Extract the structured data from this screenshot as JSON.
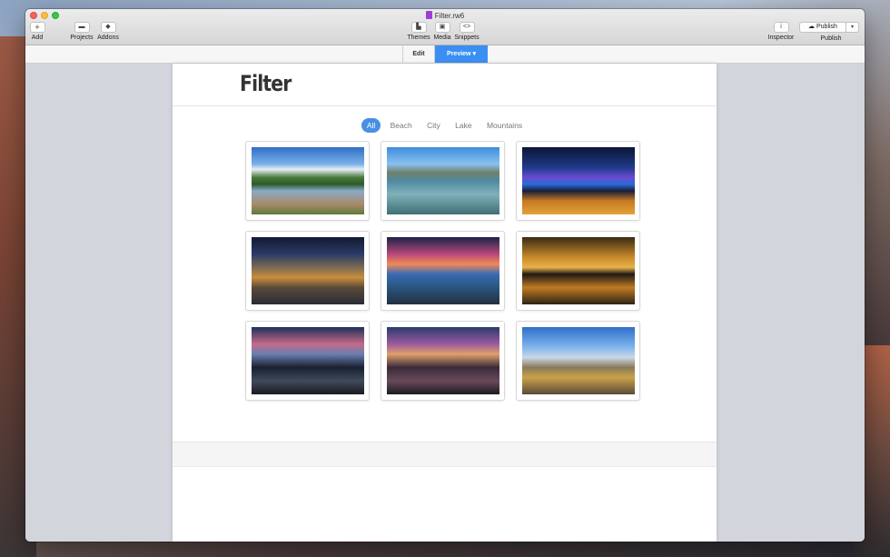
{
  "window": {
    "title": "Filter.rw6"
  },
  "toolbar": {
    "add_icon": "+",
    "add_label": "Add",
    "projects_label": "Projects",
    "addons_label": "Addons",
    "themes_label": "Themes",
    "media_label": "Media",
    "snippets_icon": "<>",
    "snippets_label": "Snippets",
    "inspector_icon": "i",
    "inspector_label": "Inspector",
    "publish_button": "Publish",
    "publish_caret": "▾",
    "publish_label": "Publish"
  },
  "modes": {
    "edit": "Edit",
    "preview": "Preview ▾"
  },
  "page": {
    "title": "Filter",
    "filters": [
      "All",
      "Beach",
      "City",
      "Lake",
      "Mountains"
    ],
    "active_filter": "All",
    "gallery_count_note": "9 photos"
  },
  "colors": {
    "accent": "#3b8ff3",
    "filter_active": "#4a90e2"
  }
}
